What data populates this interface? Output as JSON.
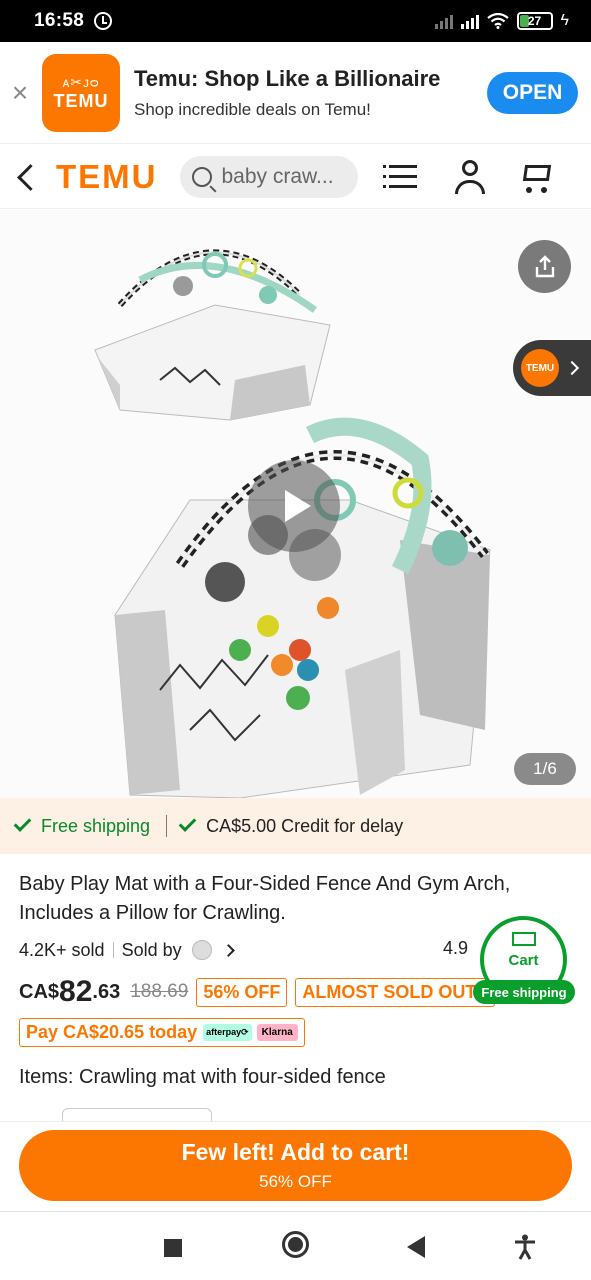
{
  "status_bar": {
    "time": "16:58",
    "battery": "27"
  },
  "app_banner": {
    "logo_glyphs": "ᴀ✂ᴊᴑ",
    "logo_word": "TEMU",
    "title": "Temu: Shop Like a Billionaire",
    "subtitle": "Shop incredible deals on Temu!",
    "open_label": "OPEN",
    "close_glyph": "×"
  },
  "header": {
    "brand": "TEMU",
    "search_query": "baby craw..."
  },
  "gallery": {
    "counter": "1/6",
    "side_logo": "TEMU"
  },
  "shipping_strip": {
    "free_shipping": "Free shipping",
    "credit": "CA$5.00 Credit for delay"
  },
  "product": {
    "title": "Baby Play Mat with a Four-Sided Fence And Gym Arch, Includes a Pillow for Crawling.",
    "sold": "4.2K+ sold",
    "sold_by": "Sold by",
    "rating": "4.9",
    "currency": "CA$",
    "price_major": "82",
    "price_minor": ".63",
    "original_price": "188.69",
    "discount_tag": "56% OFF",
    "almost_sold_tag": "ALMOST SOLD OUT",
    "pay_today": "Pay CA$20.65 today",
    "afterpay": "afterpay⟳",
    "klarna": "Klarna",
    "items_label": "Items: Crawling mat with four-sided fence"
  },
  "floating_cart": {
    "label": "Cart",
    "badge": "Free shipping"
  },
  "add_to_cart": {
    "line1": "Few left! Add to cart!",
    "line2": "56% OFF"
  },
  "colors": {
    "brand_orange": "#fb7701",
    "green": "#0a9e2c",
    "open_blue": "#1a8cf0"
  }
}
